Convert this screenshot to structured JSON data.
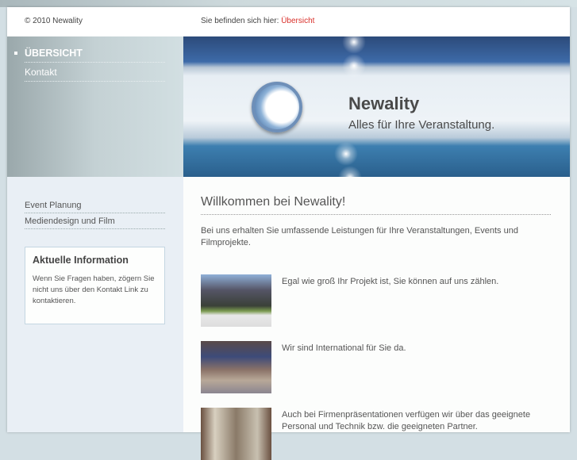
{
  "header": {
    "copyright": "© 2010 Newality",
    "breadcrumb_label": "Sie befinden sich hier:",
    "breadcrumb_current": "Übersicht"
  },
  "nav": {
    "items": [
      {
        "label": "ÜBERSICHT",
        "active": true
      },
      {
        "label": "Kontakt",
        "active": false
      }
    ]
  },
  "banner": {
    "title": "Newality",
    "subtitle": "Alles für Ihre Veranstaltung."
  },
  "subnav": {
    "items": [
      "Event Planung",
      "Mediendesign und Film"
    ]
  },
  "info": {
    "title": "Aktuelle Information",
    "text": "Wenn Sie Fragen haben, zögern Sie nicht uns über den Kontakt Link zu kontaktieren."
  },
  "main": {
    "title": "Willkommen bei Newality!",
    "intro": "Bei uns erhalten Sie umfassende Leistungen für Ihre Veranstaltungen, Events und Filmprojekte.",
    "rows": [
      "Egal wie groß Ihr Projekt ist, Sie können auf uns zählen.",
      "Wir sind International für Sie da.",
      "Auch bei Firmenpräsentationen verfügen wir über das geeignete Personal und Technik bzw. die geeigneten Partner."
    ]
  },
  "colors": {
    "accent": "#d9302a"
  }
}
